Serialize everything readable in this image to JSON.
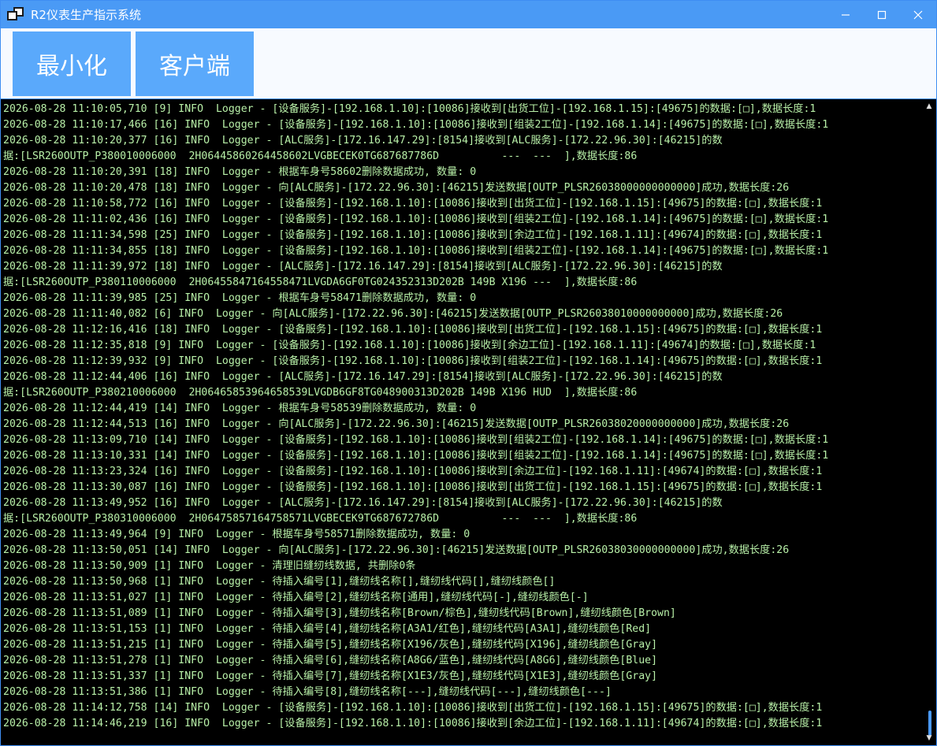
{
  "window": {
    "title": "R2仪表生产指示系统"
  },
  "toolbar": {
    "minimize_label": "最小化",
    "client_label": "客户端"
  },
  "colors": {
    "titlebar": "#4a9af5",
    "button": "#5aa9fb",
    "log_background": "#000000",
    "log_text": "#b8f0a8"
  },
  "icons": {
    "app": "app-window-icon",
    "minimize": "window-minimize-icon",
    "maximize": "window-maximize-icon",
    "close": "window-close-icon",
    "scroll_up": "scroll-up-arrow-icon",
    "scroll_down": "scroll-down-arrow-icon"
  },
  "log": {
    "lines": [
      "2026-08-28 11:10:05,710 [9] INFO  Logger - [设备服务]-[192.168.1.10]:[10086]接收到[出货工位]-[192.168.1.15]:[49675]的数据:[□],数据长度:1",
      "2026-08-28 11:10:17,466 [16] INFO  Logger - [设备服务]-[192.168.1.10]:[10086]接收到[组装2工位]-[192.168.1.14]:[49675]的数据:[□],数据长度:1",
      "2026-08-28 11:10:20,377 [16] INFO  Logger - [ALC服务]-[172.16.147.29]:[8154]接收到[ALC服务]-[172.22.96.30]:[46215]的数",
      "据:[LSR260OUTP_P380010006000  2H06445860264458602LVGBECEK0TG687687786D          ---  ---  ],数据长度:86",
      "2026-08-28 11:10:20,391 [18] INFO  Logger - 根据车身号58602删除数据成功, 数量: 0",
      "2026-08-28 11:10:20,478 [18] INFO  Logger - 向[ALC服务]-[172.22.96.30]:[46215]发送数据[OUTP_PLSR26038000000000000]成功,数据长度:26",
      "2026-08-28 11:10:58,772 [16] INFO  Logger - [设备服务]-[192.168.1.10]:[10086]接收到[出货工位]-[192.168.1.15]:[49675]的数据:[□],数据长度:1",
      "2026-08-28 11:11:02,436 [16] INFO  Logger - [设备服务]-[192.168.1.10]:[10086]接收到[组装2工位]-[192.168.1.14]:[49675]的数据:[□],数据长度:1",
      "2026-08-28 11:11:34,598 [25] INFO  Logger - [设备服务]-[192.168.1.10]:[10086]接收到[余边工位]-[192.168.1.11]:[49674]的数据:[□],数据长度:1",
      "2026-08-28 11:11:34,855 [18] INFO  Logger - [设备服务]-[192.168.1.10]:[10086]接收到[组装2工位]-[192.168.1.14]:[49675]的数据:[□],数据长度:1",
      "2026-08-28 11:11:39,972 [18] INFO  Logger - [ALC服务]-[172.16.147.29]:[8154]接收到[ALC服务]-[172.22.96.30]:[46215]的数",
      "据:[LSR260OUTP_P380110006000  2H06455847164558471LVGDA6GF0TG024352313D202B 149B X196 ---  ],数据长度:86",
      "2026-08-28 11:11:39,985 [25] INFO  Logger - 根据车身号58471删除数据成功, 数量: 0",
      "2026-08-28 11:11:40,082 [6] INFO  Logger - 向[ALC服务]-[172.22.96.30]:[46215]发送数据[OUTP_PLSR26038010000000000]成功,数据长度:26",
      "2026-08-28 11:12:16,416 [18] INFO  Logger - [设备服务]-[192.168.1.10]:[10086]接收到[出货工位]-[192.168.1.15]:[49675]的数据:[□],数据长度:1",
      "2026-08-28 11:12:35,818 [9] INFO  Logger - [设备服务]-[192.168.1.10]:[10086]接收到[余边工位]-[192.168.1.11]:[49674]的数据:[□],数据长度:1",
      "2026-08-28 11:12:39,932 [9] INFO  Logger - [设备服务]-[192.168.1.10]:[10086]接收到[组装2工位]-[192.168.1.14]:[49675]的数据:[□],数据长度:1",
      "2026-08-28 11:12:44,406 [16] INFO  Logger - [ALC服务]-[172.16.147.29]:[8154]接收到[ALC服务]-[172.22.96.30]:[46215]的数",
      "据:[LSR260OUTP_P380210006000  2H06465853964658539LVGDB6GF8TG048900313D202B 149B X196 HUD  ],数据长度:86",
      "2026-08-28 11:12:44,419 [14] INFO  Logger - 根据车身号58539删除数据成功, 数量: 0",
      "2026-08-28 11:12:44,513 [16] INFO  Logger - 向[ALC服务]-[172.22.96.30]:[46215]发送数据[OUTP_PLSR26038020000000000]成功,数据长度:26",
      "2026-08-28 11:13:09,710 [14] INFO  Logger - [设备服务]-[192.168.1.10]:[10086]接收到[组装2工位]-[192.168.1.14]:[49675]的数据:[□],数据长度:1",
      "2026-08-28 11:13:10,331 [14] INFO  Logger - [设备服务]-[192.168.1.10]:[10086]接收到[组装2工位]-[192.168.1.14]:[49675]的数据:[□],数据长度:1",
      "2026-08-28 11:13:23,324 [16] INFO  Logger - [设备服务]-[192.168.1.10]:[10086]接收到[余边工位]-[192.168.1.11]:[49674]的数据:[□],数据长度:1",
      "2026-08-28 11:13:30,087 [16] INFO  Logger - [设备服务]-[192.168.1.10]:[10086]接收到[出货工位]-[192.168.1.15]:[49675]的数据:[□],数据长度:1",
      "2026-08-28 11:13:49,952 [16] INFO  Logger - [ALC服务]-[172.16.147.29]:[8154]接收到[ALC服务]-[172.22.96.30]:[46215]的数",
      "据:[LSR260OUTP_P380310006000  2H06475857164758571LVGBECEK9TG687672786D          ---  ---  ],数据长度:86",
      "2026-08-28 11:13:49,964 [9] INFO  Logger - 根据车身号58571删除数据成功, 数量: 0",
      "2026-08-28 11:13:50,051 [14] INFO  Logger - 向[ALC服务]-[172.22.96.30]:[46215]发送数据[OUTP_PLSR26038030000000000]成功,数据长度:26",
      "2026-08-28 11:13:50,909 [1] INFO  Logger - 清理旧缝纫线数据, 共删除0条",
      "2026-08-28 11:13:50,968 [1] INFO  Logger - 待插入编号[1],缝纫线名称[],缝纫线代码[],缝纫线颜色[]",
      "2026-08-28 11:13:51,027 [1] INFO  Logger - 待插入编号[2],缝纫线名称[通用],缝纫线代码[-],缝纫线颜色[-]",
      "2026-08-28 11:13:51,089 [1] INFO  Logger - 待插入编号[3],缝纫线名称[Brown/棕色],缝纫线代码[Brown],缝纫线颜色[Brown]",
      "2026-08-28 11:13:51,153 [1] INFO  Logger - 待插入编号[4],缝纫线名称[A3A1/红色],缝纫线代码[A3A1],缝纫线颜色[Red]",
      "2026-08-28 11:13:51,215 [1] INFO  Logger - 待插入编号[5],缝纫线名称[X196/灰色],缝纫线代码[X196],缝纫线颜色[Gray]",
      "2026-08-28 11:13:51,278 [1] INFO  Logger - 待插入编号[6],缝纫线名称[A8G6/蓝色],缝纫线代码[A8G6],缝纫线颜色[Blue]",
      "2026-08-28 11:13:51,337 [1] INFO  Logger - 待插入编号[7],缝纫线名称[X1E3/灰色],缝纫线代码[X1E3],缝纫线颜色[Gray]",
      "2026-08-28 11:13:51,386 [1] INFO  Logger - 待插入编号[8],缝纫线名称[---],缝纫线代码[---],缝纫线颜色[---]",
      "2026-08-28 11:14:12,758 [14] INFO  Logger - [设备服务]-[192.168.1.10]:[10086]接收到[出货工位]-[192.168.1.15]:[49675]的数据:[□],数据长度:1",
      "2026-08-28 11:14:46,219 [16] INFO  Logger - [设备服务]-[192.168.1.10]:[10086]接收到[余边工位]-[192.168.1.11]:[49674]的数据:[□],数据长度:1"
    ]
  }
}
